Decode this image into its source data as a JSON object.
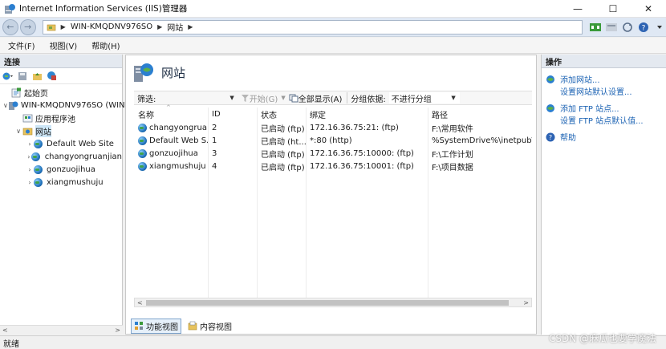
{
  "window": {
    "title": "Internet Information Services (IIS)管理器",
    "minimize": "—",
    "maximize": "☐",
    "close": "✕"
  },
  "address": {
    "back": "←",
    "forward": "→",
    "segments": [
      "WIN-KMQDNV976SO",
      "网站"
    ],
    "sep": "▶"
  },
  "menu": {
    "items": [
      "文件(F)",
      "视图(V)",
      "帮助(H)"
    ]
  },
  "connections": {
    "header": "连接",
    "tree": [
      {
        "label": "起始页",
        "expander": "",
        "level": 0
      },
      {
        "label": "WIN-KMQDNV976SO (WIN",
        "expander": "∨",
        "level": 0
      },
      {
        "label": "应用程序池",
        "expander": "",
        "level": 1
      },
      {
        "label": "网站",
        "expander": "∨",
        "level": 1
      },
      {
        "label": "Default Web Site",
        "expander": "›",
        "level": 2
      },
      {
        "label": "changyongruanjian",
        "expander": "›",
        "level": 2
      },
      {
        "label": "gonzuojihua",
        "expander": "›",
        "level": 2
      },
      {
        "label": "xiangmushuju",
        "expander": "›",
        "level": 2
      }
    ]
  },
  "center": {
    "title": "网站",
    "filter": {
      "label": "筛选:",
      "start_label": "开始(G)",
      "show_all_label": "全部显示(A)",
      "group_label": "分组依据:",
      "group_value": "不进行分组"
    },
    "columns": [
      "名称",
      "ID",
      "状态",
      "绑定",
      "路径"
    ],
    "rows": [
      {
        "name": "changyongrua...",
        "id": "2",
        "status": "已启动 (ftp)",
        "binding": "172.16.36.75:21: (ftp)",
        "path": "F:\\常用软件"
      },
      {
        "name": "Default Web S...",
        "id": "1",
        "status": "已启动 (ht...",
        "binding": "*:80 (http)",
        "path": "%SystemDrive%\\inetpub\\w"
      },
      {
        "name": "gonzuojihua",
        "id": "3",
        "status": "已启动 (ftp)",
        "binding": "172.16.36.75:10000: (ftp)",
        "path": "F:\\工作计划"
      },
      {
        "name": "xiangmushuju",
        "id": "4",
        "status": "已启动 (ftp)",
        "binding": "172.16.36.75:10001: (ftp)",
        "path": "F:\\项目数据"
      }
    ],
    "view_tabs": [
      "功能视图",
      "内容视图"
    ]
  },
  "actions": {
    "header": "操作",
    "groups": [
      [
        "添加网站...",
        "设置网站默认设置..."
      ],
      [
        "添加 FTP 站点...",
        "设置 FTP 站点默认值..."
      ],
      [
        "帮助"
      ]
    ]
  },
  "status": {
    "text": "就绪"
  },
  "watermark": "CSDN @麻瓜也要学魔法"
}
